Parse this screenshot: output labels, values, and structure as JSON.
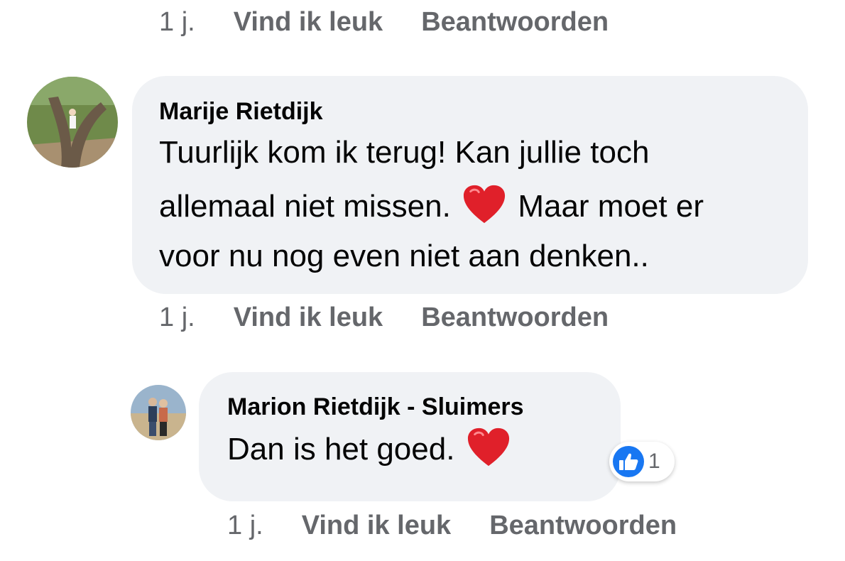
{
  "previous_comment": {
    "time": "1 j.",
    "like_label": "Vind ik leuk",
    "reply_label": "Beantwoorden"
  },
  "comment": {
    "author": "Marije Rietdijk",
    "line1": "Tuurlijk kom ik terug! Kan jullie toch",
    "line2_before": "allemaal niet missen.",
    "line2_after": "Maar moet er",
    "line3": "voor nu nog even niet aan denken..",
    "emoji": "heart-emoji",
    "time": "1 j.",
    "like_label": "Vind ik leuk",
    "reply_label": "Beantwoorden"
  },
  "reply": {
    "author": "Marion Rietdijk - Sluimers",
    "text": "Dan is het goed.",
    "emoji": "heart-emoji",
    "reaction_icon": "thumbs-up-icon",
    "reaction_count": "1",
    "time": "1 j.",
    "like_label": "Vind ik leuk",
    "reply_label": "Beantwoorden"
  },
  "colors": {
    "bubble": "#f0f2f5",
    "meta_text": "#65676b",
    "like_blue": "#1877f2",
    "heart_red": "#e0202a"
  }
}
